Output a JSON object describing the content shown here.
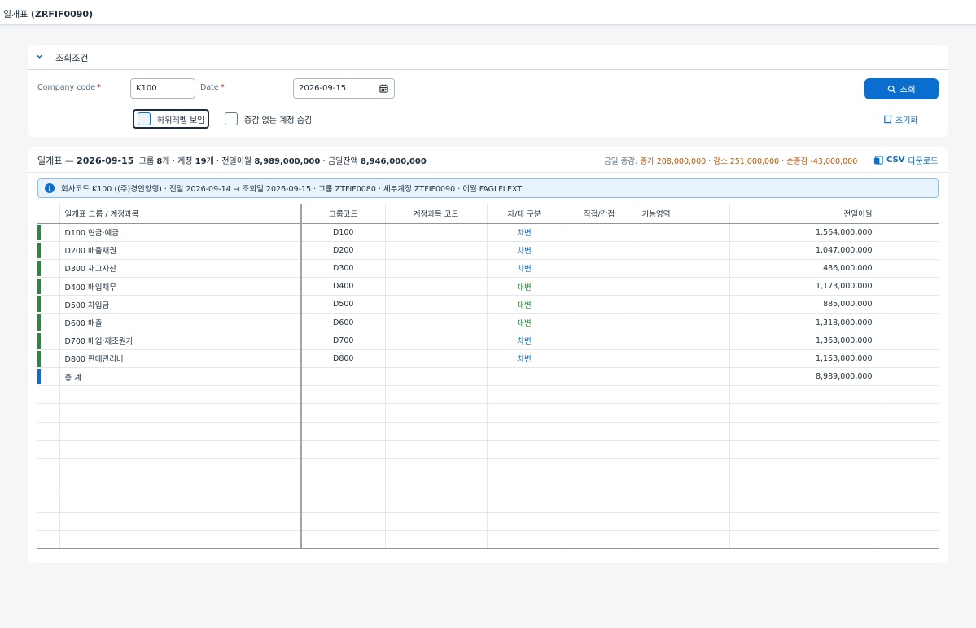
{
  "app": {
    "title_prefix": "일개표",
    "title_code": "(ZRFIF0090)"
  },
  "filter": {
    "section_title": "조회조건",
    "company_label": "Company code",
    "company_value": "K100",
    "date_label": "Date",
    "date_value": "2026-09-15",
    "required_mark": "*",
    "search_button": "조회",
    "reset_button": "초기화",
    "show_sublevel_label": "하위레벨 보임",
    "hide_zero_label": "증감 없는 계정 숨김"
  },
  "summary": {
    "title_prefix": "일개표 —",
    "title_date": "2026-09-15",
    "group_label": "그룹",
    "group_count": "8",
    "account_label": "개 · 계정",
    "account_count": "19",
    "prev_label": "개 · 전일이월",
    "prev_amount": "8,989,000,000",
    "cur_label": "· 금일잔액",
    "cur_amount": "8,946,000,000",
    "delta_label": "금일 증감:",
    "delta_text": "증가 208,000,000 · 감소 251,000,000 · 순증감 -43,000,000",
    "csv_prefix": "CSV",
    "csv_label": "다운로드"
  },
  "info_text": "회사코드 K100 ((주)경인양행) · 전일 2026-09-14 → 조회일 2026-09-15 · 그룹 ZTFIF0080 · 세부계정 ZTFIF0090 · 이월 FAGLFLEXT",
  "table": {
    "columns": [
      "일개표 그룹 / 계정과목",
      "그룹코드",
      "계정과목 코드",
      "차/대 구분",
      "직접/간접",
      "기능영역",
      "전일이월"
    ],
    "rows": [
      {
        "name": "D100 현금·예금",
        "group": "D100",
        "account": "",
        "dc": "차변",
        "dc_type": "dr",
        "direct": "",
        "area": "",
        "prev": "1,564,000,000"
      },
      {
        "name": "D200 매출채권",
        "group": "D200",
        "account": "",
        "dc": "차변",
        "dc_type": "dr",
        "direct": "",
        "area": "",
        "prev": "1,047,000,000"
      },
      {
        "name": "D300 재고자산",
        "group": "D300",
        "account": "",
        "dc": "차변",
        "dc_type": "dr",
        "direct": "",
        "area": "",
        "prev": "486,000,000"
      },
      {
        "name": "D400 매입채무",
        "group": "D400",
        "account": "",
        "dc": "대변",
        "dc_type": "cr",
        "direct": "",
        "area": "",
        "prev": "1,173,000,000"
      },
      {
        "name": "D500 차입금",
        "group": "D500",
        "account": "",
        "dc": "대변",
        "dc_type": "cr",
        "direct": "",
        "area": "",
        "prev": "885,000,000"
      },
      {
        "name": "D600 매출",
        "group": "D600",
        "account": "",
        "dc": "대변",
        "dc_type": "cr",
        "direct": "",
        "area": "",
        "prev": "1,318,000,000"
      },
      {
        "name": "D700 매입·제조원가",
        "group": "D700",
        "account": "",
        "dc": "차변",
        "dc_type": "dr",
        "direct": "",
        "area": "",
        "prev": "1,363,000,000"
      },
      {
        "name": "D800 판매관리비",
        "group": "D800",
        "account": "",
        "dc": "차변",
        "dc_type": "dr",
        "direct": "",
        "area": "",
        "prev": "1,153,000,000"
      }
    ],
    "total": {
      "name": "총 계",
      "prev": "8,989,000,000"
    }
  },
  "colors": {
    "accent": "#0a6ed1",
    "debit": "#0a6ed1",
    "credit": "#2e8540",
    "delta": "#c35500"
  }
}
